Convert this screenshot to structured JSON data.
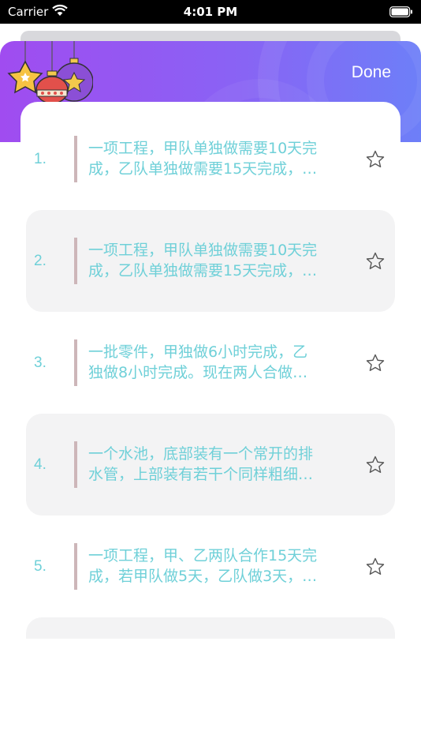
{
  "status": {
    "carrier": "Carrier",
    "time": "4:01 PM"
  },
  "header": {
    "done_label": "Done"
  },
  "colors": {
    "accent": "#6fd0d8",
    "header_start": "#a04cf0",
    "header_end": "#6d7ff8",
    "bar": "#cdb6b9"
  },
  "items": [
    {
      "num": "1.",
      "line1": "一项工程，甲队单独做需要10天完",
      "line2": "成，乙队单独做需要15天完成，…",
      "icon": "star-outline-icon"
    },
    {
      "num": "2.",
      "line1": "一项工程，甲队单独做需要10天完",
      "line2": "成，乙队单独做需要15天完成，…",
      "icon": "star-outline-icon"
    },
    {
      "num": "3.",
      "line1": "一批零件，甲独做6小时完成，乙",
      "line2": "独做8小时完成。现在两人合做…",
      "icon": "star-outline-icon"
    },
    {
      "num": "4.",
      "line1": "一个水池，底部装有一个常开的排",
      "line2": "水管，上部装有若干个同样粗细…",
      "icon": "star-outline-icon"
    },
    {
      "num": "5.",
      "line1": "一项工程，甲、乙两队合作15天完",
      "line2": "成，若甲队做5天，乙队做3天，…",
      "icon": "star-outline-icon"
    },
    {
      "num": "",
      "line1": "",
      "line2": "",
      "icon": ""
    }
  ]
}
